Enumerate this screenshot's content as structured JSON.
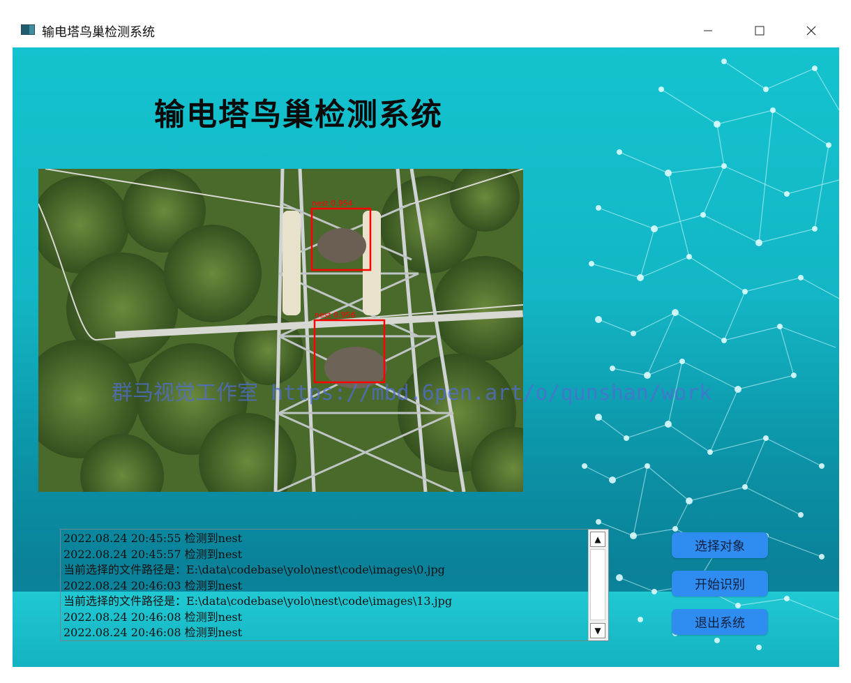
{
  "window": {
    "title": "输电塔鸟巢检测系统",
    "controls": {
      "minimize": "—",
      "maximize": "☐",
      "close": "✕"
    }
  },
  "app": {
    "heading": "输电塔鸟巢检测系统",
    "watermark": "群马视觉工作室 https://mbd.6pen.art/o/qunshan/work"
  },
  "detections": [
    {
      "label": "nest 0.954"
    },
    {
      "label": "nest 0.956"
    }
  ],
  "log": {
    "lines": [
      "2022.08.24 20:45:55 检测到nest",
      "2022.08.24 20:45:57 检测到nest",
      "当前选择的文件路径是：E:\\data\\codebase\\yolo\\nest\\code\\images\\0.jpg",
      "2022.08.24 20:46:03 检测到nest",
      "当前选择的文件路径是：E:\\data\\codebase\\yolo\\nest\\code\\images\\13.jpg",
      "2022.08.24 20:46:08 检测到nest",
      "2022.08.24 20:46:08 检测到nest"
    ]
  },
  "buttons": {
    "select": "选择对象",
    "start": "开始识别",
    "exit": "退出系统"
  },
  "colors": {
    "background_teal": "#13b6c6",
    "button_blue": "#2f8cf0",
    "detection_box": "#ff0000"
  }
}
